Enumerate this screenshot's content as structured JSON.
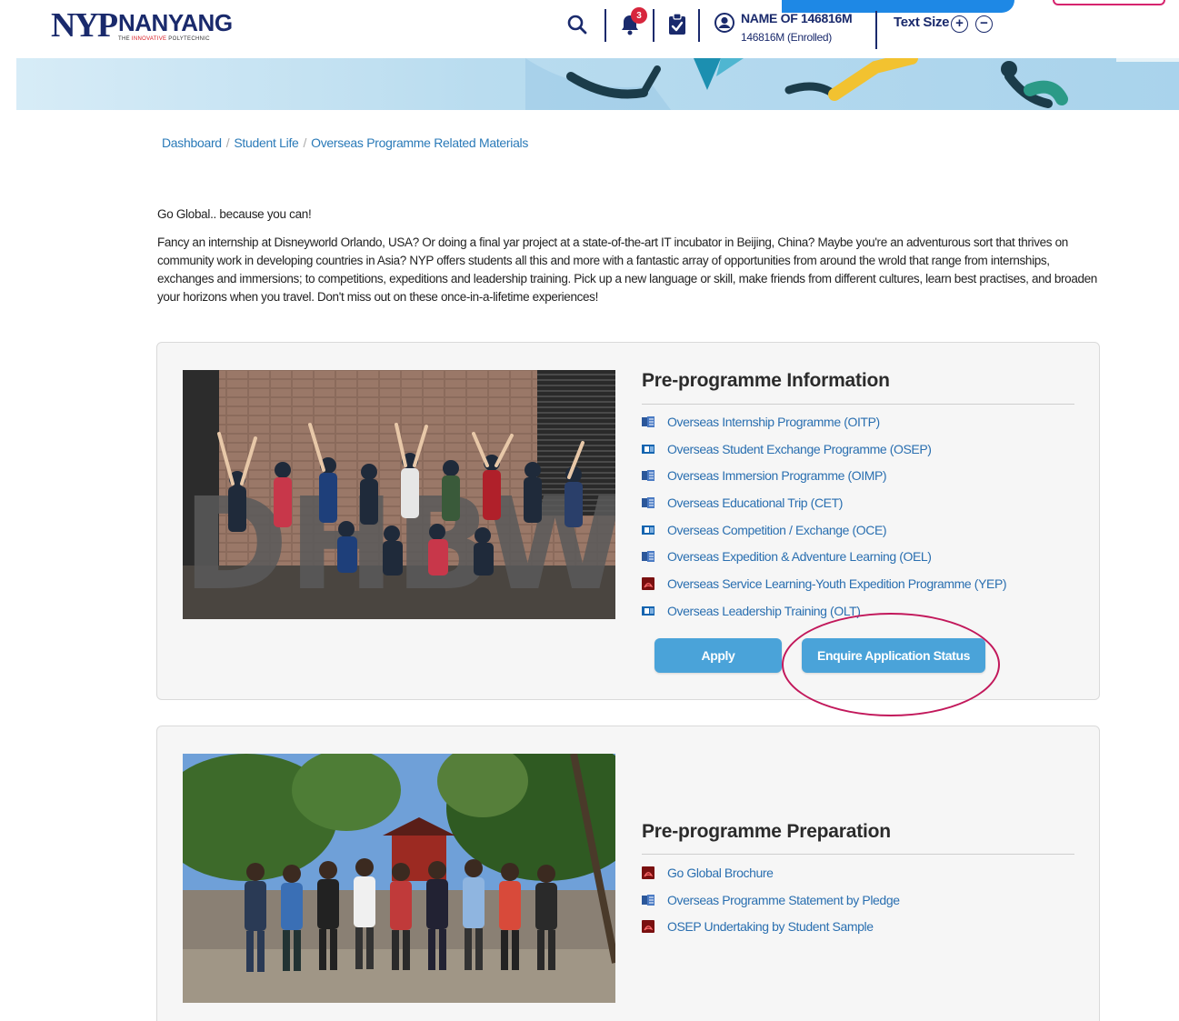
{
  "header": {
    "logo_mark": "NYP",
    "logo_name": "NANYANG",
    "logo_tag_prefix": "THE ",
    "logo_tag_highlight": "INNOVATIVE",
    "logo_tag_suffix": " POLYTECHNIC",
    "notification_count": "3",
    "user_name": "NAME OF 146816M",
    "user_id": "146816M (Enrolled)",
    "text_size_label": "Text Size",
    "text_size_increase": "+",
    "text_size_decrease": "−"
  },
  "breadcrumb": {
    "items": [
      "Dashboard",
      "Student Life",
      "Overseas Programme Related Materials"
    ],
    "separator": "/"
  },
  "intro": {
    "title": "Go Global.. because you can!",
    "body": "Fancy an internship at Disneyworld Orlando, USA? Or doing a final yar project at a state-of-the-art IT incubator in Beijing, China? Maybe you're an adventurous sort that thrives on community work in developing countries in Asia? NYP offers students all this and more with a fantastic array of opportunities from around the wrold that range from internships, exchanges and immersions; to competitions, expeditions and leadership training. Pick up a new language or skill, make friends from different cultures, learn best practises, and broaden your horizons when you travel. Don't miss out on these once-in-a-lifetime experiences!"
  },
  "info_section": {
    "title": "Pre-programme Information",
    "items": [
      {
        "label": "Overseas Internship Programme (OITP)",
        "icon": "word-doc-icon"
      },
      {
        "label": "Overseas Student Exchange Programme (OSEP)",
        "icon": "outlook-doc-icon"
      },
      {
        "label": "Overseas Immersion Programme (OIMP)",
        "icon": "word-doc-icon"
      },
      {
        "label": "Overseas Educational Trip (CET)",
        "icon": "word-doc-icon"
      },
      {
        "label": "Overseas Competition / Exchange (OCE)",
        "icon": "outlook-doc-icon"
      },
      {
        "label": "Overseas Expedition & Adventure Learning (OEL)",
        "icon": "word-doc-icon"
      },
      {
        "label": "Overseas Service Learning-Youth Expedition Programme (YEP)",
        "icon": "pdf-icon"
      },
      {
        "label": "Overseas Leadership Training (OLT)",
        "icon": "outlook-doc-icon"
      }
    ],
    "apply_label": "Apply",
    "enquire_label": "Enquire Application Status"
  },
  "prep_section": {
    "title": "Pre-programme Preparation",
    "items": [
      {
        "label": "Go Global Brochure",
        "icon": "pdf-icon"
      },
      {
        "label": "Overseas Programme Statement by Pledge",
        "icon": "word-doc-icon"
      },
      {
        "label": "OSEP Undertaking by Student Sample",
        "icon": "pdf-icon"
      }
    ]
  },
  "colors": {
    "brand_navy": "#1a2a6c",
    "brand_red": "#d71920",
    "link": "#2a6fb0",
    "button": "#4aa3d9",
    "annotation": "#c2185b"
  }
}
